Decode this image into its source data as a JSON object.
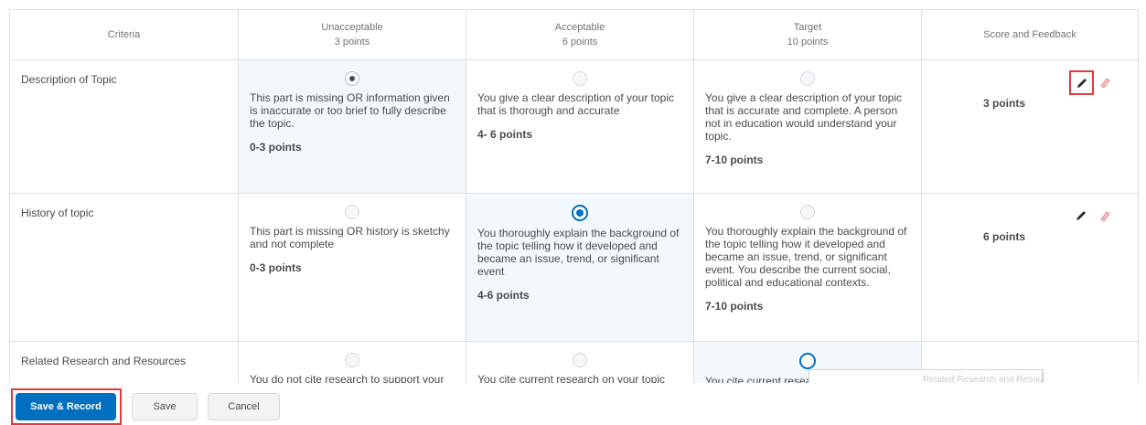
{
  "rubric": {
    "headers": {
      "criteria": "Criteria",
      "levels": [
        {
          "name": "Unacceptable",
          "points": "3 points"
        },
        {
          "name": "Acceptable",
          "points": "6 points"
        },
        {
          "name": "Target",
          "points": "10 points"
        }
      ],
      "score": "Score and Feedback"
    },
    "rows": [
      {
        "criterion": "Description of Topic",
        "selected_level": "Unacceptable",
        "levels": [
          {
            "desc": "This part is missing OR information given is inaccurate or too brief to fully describe the topic.",
            "points": "0-3 points"
          },
          {
            "desc": "You give a clear description of your topic that is thorough and accurate",
            "points": "4- 6 points"
          },
          {
            "desc": "You give a clear description of your topic that is accurate and complete. A person not in education would understand your topic.",
            "points": "7-10 points"
          }
        ],
        "score": "3 points"
      },
      {
        "criterion": "History of topic",
        "selected_level": "Acceptable",
        "levels": [
          {
            "desc": "This part is missing OR history is sketchy and not complete",
            "points": "0-3 points"
          },
          {
            "desc": "You thoroughly explain the background of the topic telling how it developed and became an issue, trend, or significant event",
            "points": "4-6 points"
          },
          {
            "desc": "You thoroughly explain the background of the topic telling how it developed and became an issue, trend, or significant event. You describe the current social, political and educational contexts.",
            "points": "7-10 points"
          }
        ],
        "score": "6 points"
      },
      {
        "criterion": "Related Research and Resources",
        "selected_level": "",
        "levels": [
          {
            "desc": "You do not cite research to support your"
          },
          {
            "desc": "You cite current research on your topic"
          },
          {
            "desc": "You cite current research on your topic"
          }
        ],
        "score": ""
      }
    ]
  },
  "tooltip": "Related Research and Resources",
  "footer": {
    "save_record": "Save & Record",
    "save": "Save",
    "cancel": "Cancel"
  },
  "icons": {
    "edit": "pencil-icon",
    "clear": "eraser-icon"
  },
  "colors": {
    "primary": "#006fbf",
    "highlight_outline": "#e0393e",
    "selected_cell_bg": "#f2f8fc"
  }
}
